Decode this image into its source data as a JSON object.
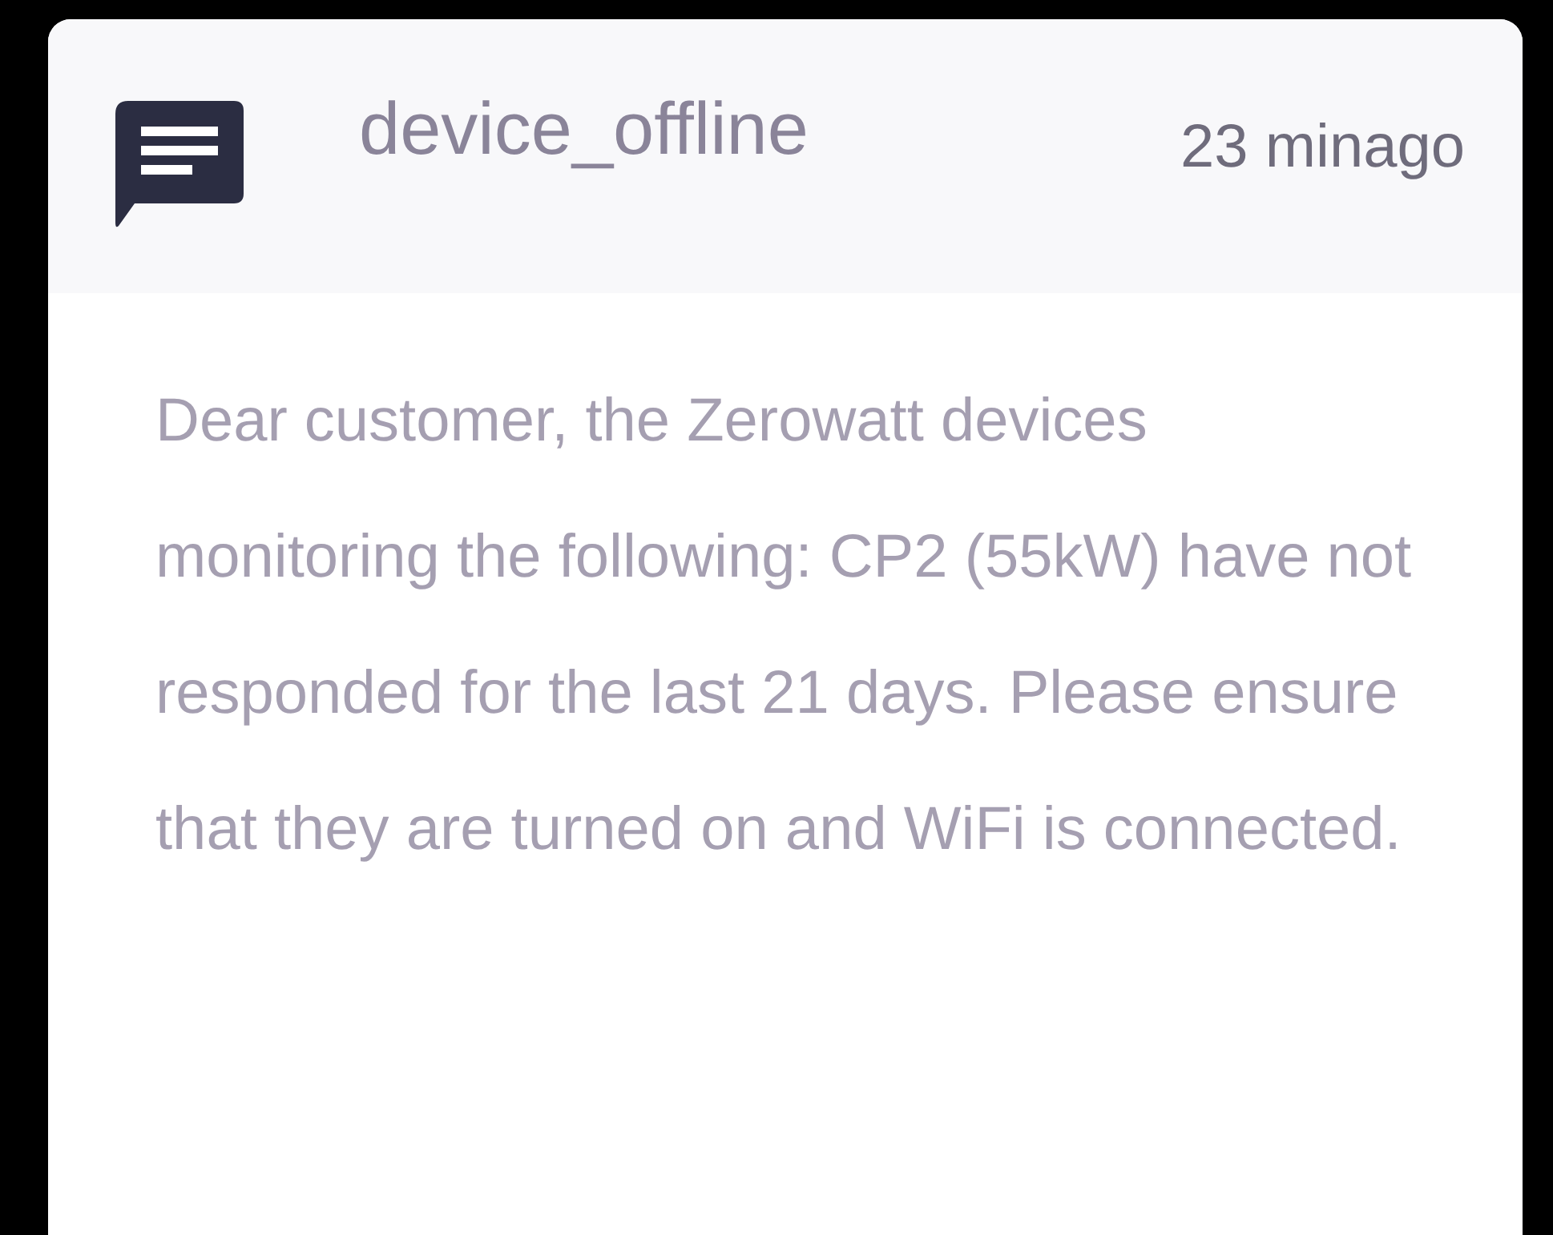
{
  "notification": {
    "title": "device_offline",
    "time": "23 minago",
    "message": "Dear customer, the Zerowatt devices monitoring the following: CP2 (55kW) have not responded for the last 21 days. Please ensure that they are turned on and WiFi is connected."
  }
}
